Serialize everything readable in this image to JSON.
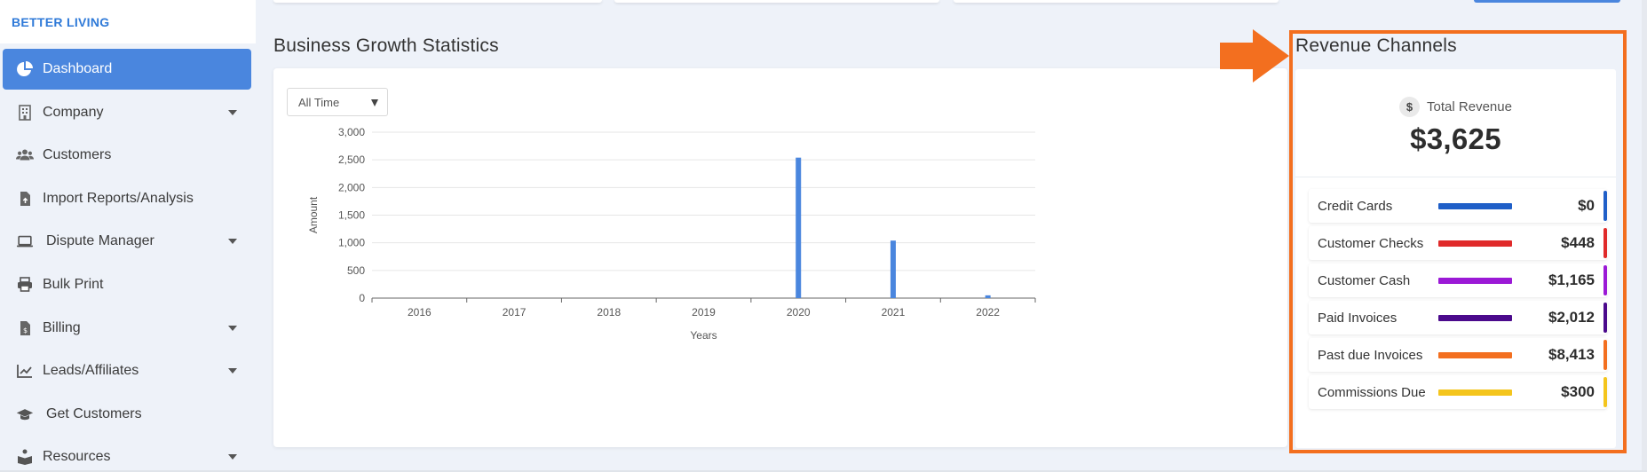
{
  "brand": {
    "name": "BETTER LIVING"
  },
  "sidebar": {
    "items": [
      {
        "label": "Dashboard",
        "icon": "pie-chart-icon",
        "active": true,
        "has_caret": false
      },
      {
        "label": "Company",
        "icon": "building-icon",
        "active": false,
        "has_caret": true
      },
      {
        "label": "Customers",
        "icon": "users-icon",
        "active": false,
        "has_caret": false
      },
      {
        "label": "Import Reports/Analysis",
        "icon": "file-upload-icon",
        "active": false,
        "has_caret": false
      },
      {
        "label": "Dispute Manager",
        "icon": "laptop-icon",
        "active": false,
        "has_caret": true
      },
      {
        "label": "Bulk Print",
        "icon": "printer-icon",
        "active": false,
        "has_caret": false
      },
      {
        "label": "Billing",
        "icon": "invoice-icon",
        "active": false,
        "has_caret": true
      },
      {
        "label": "Leads/Affiliates",
        "icon": "chart-line-icon",
        "active": false,
        "has_caret": true
      },
      {
        "label": "Get Customers",
        "icon": "graduation-cap-icon",
        "active": false,
        "has_caret": false
      },
      {
        "label": "Resources",
        "icon": "book-reader-icon",
        "active": false,
        "has_caret": true
      }
    ]
  },
  "growth": {
    "title": "Business Growth Statistics",
    "filter": {
      "selected": "All Time"
    }
  },
  "chart_data": {
    "type": "bar",
    "categories": [
      "2016",
      "2017",
      "2018",
      "2019",
      "2020",
      "2021",
      "2022"
    ],
    "values": [
      0,
      0,
      0,
      0,
      2540,
      1040,
      50
    ],
    "xlabel": "Years",
    "ylabel": "Amount",
    "ylim": [
      0,
      3000
    ],
    "yticks": [
      0,
      500,
      1000,
      1500,
      2000,
      2500,
      3000
    ],
    "ytick_labels": [
      "0",
      "500",
      "1,000",
      "1,500",
      "2,000",
      "2,500",
      "3,000"
    ],
    "grid": true,
    "bar_color": "#4a86de"
  },
  "revenue": {
    "title": "Revenue Channels",
    "total_label": "Total Revenue",
    "total_value": "$3,625",
    "highlight_color": "#f36f1f",
    "channels": [
      {
        "name": "Credit Cards",
        "value": "$0",
        "color": "#1f5fc8"
      },
      {
        "name": "Customer Checks",
        "value": "$448",
        "color": "#e02a2a"
      },
      {
        "name": "Customer Cash",
        "value": "$1,165",
        "color": "#9b19d6"
      },
      {
        "name": "Paid Invoices",
        "value": "$2,012",
        "color": "#4b0a8c"
      },
      {
        "name": "Past due Invoices",
        "value": "$8,413",
        "color": "#f36f1f"
      },
      {
        "name": "Commissions Due",
        "value": "$300",
        "color": "#f4c51d"
      }
    ]
  }
}
